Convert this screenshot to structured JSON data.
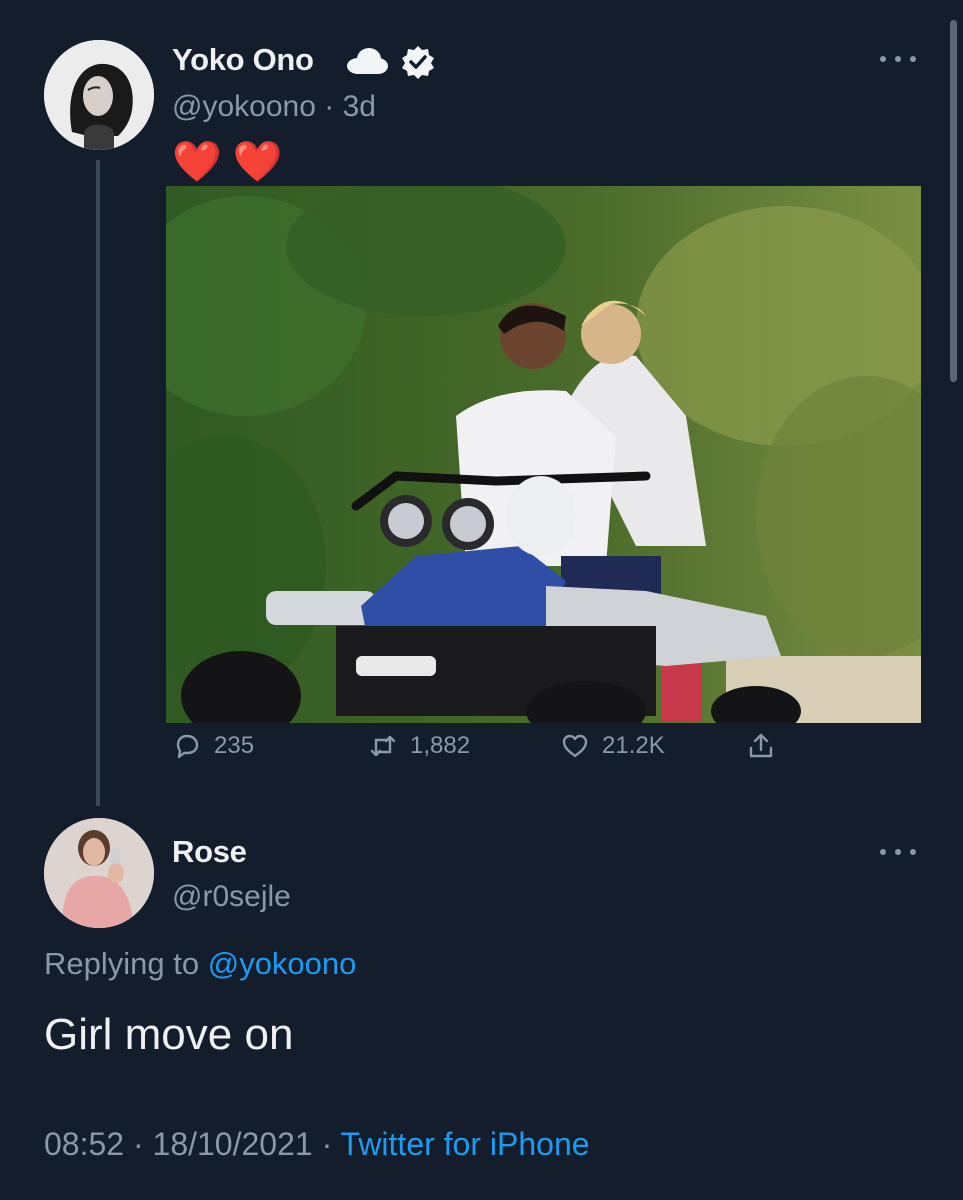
{
  "original_tweet": {
    "display_name": "Yoko Ono",
    "handle": "@yokoono",
    "separator": "·",
    "time_ago": "3d",
    "text": "❤️ ❤️",
    "stats": {
      "replies": "235",
      "retweets": "1,882",
      "likes": "21.2K"
    }
  },
  "reply_tweet": {
    "display_name": "Rose",
    "handle": "@r0sejle",
    "replying_prefix": "Replying to ",
    "replying_mention": "@yokoono",
    "text": "Girl move on",
    "time": "08:52",
    "separator": "·",
    "date": "18/10/2021",
    "source": "Twitter for iPhone"
  },
  "icons": {
    "name_emoji": "cloud-icon",
    "verified": "verified-badge-icon",
    "reply": "reply-icon",
    "retweet": "retweet-icon",
    "like": "heart-icon",
    "share": "share-icon",
    "more": "more-icon"
  },
  "colors": {
    "background": "#141d2b",
    "text_primary": "#eef0f1",
    "text_secondary": "#8b98a5",
    "accent_link": "#1d9bf0",
    "heart_emoji": "#e5394b"
  }
}
